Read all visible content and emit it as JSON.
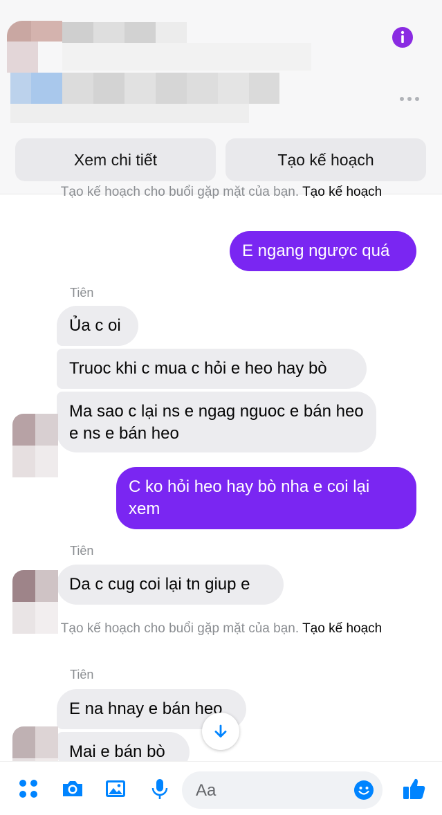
{
  "header": {
    "buttons": {
      "details": "Xem chi tiết",
      "plan": "Tạo kế hoạch"
    },
    "icons": {
      "info": "info-icon",
      "more": "more-horizontal-icon"
    },
    "accent_color": "#7a26f2"
  },
  "messages": {
    "top_note": {
      "text": "Tạo kế hoạch cho buổi gặp mặt của bạn.",
      "link": "Tạo kế hoạch"
    },
    "m1": "E ngang ngược quá",
    "sender1": "Tiên",
    "m2": "Ủa c oi",
    "m3": "Truoc khi c mua c hỏi e heo hay bò",
    "m4": "Ma sao c lại ns e ngag nguoc e bán heo e ns e bán heo",
    "m5": "C ko hỏi heo hay bò nha e coi lại xem",
    "sender2": "Tiên",
    "m6": "Da c cug coi lại tn giup e",
    "mid_note": {
      "text": "Tạo kế hoạch cho buổi gặp mặt của bạn.",
      "link": "Tạo kế hoạch"
    },
    "sender3": "Tiên",
    "m7": "E na hnay e bán heo",
    "m8": "Mai e bán bò"
  },
  "composer": {
    "placeholder": "Aa",
    "icons": [
      "apps-icon",
      "camera-icon",
      "image-icon",
      "microphone-icon",
      "emoji-icon",
      "thumbs-up-icon"
    ],
    "icon_color": "#0084ff"
  }
}
